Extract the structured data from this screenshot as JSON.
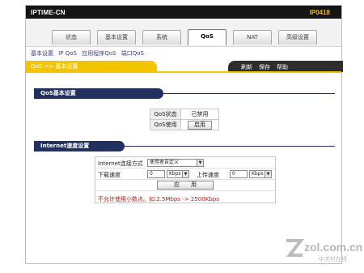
{
  "header": {
    "brand": "IPTIME-CN",
    "model": "IP0418"
  },
  "tabs": [
    "状态",
    "基本设置",
    "系统",
    "QoS",
    "NAT",
    "高级设置"
  ],
  "submenu": [
    "基本设置",
    "IP QoS",
    "应用程序QoS",
    "端口QoS"
  ],
  "page_title": "QoS >> 基本设置",
  "actions": [
    "刷新",
    "保存",
    "帮助"
  ],
  "qos_section": {
    "title": "QoS基本设置",
    "status_label": "QoS状态",
    "status_value": "已禁用",
    "use_label": "QoS使用",
    "enable_button": "启用"
  },
  "speed_section": {
    "title": "Internet速度设置",
    "method_label": "Internet连接方式",
    "method_value": "使用者自定义",
    "download_label": "下载速度",
    "download_value": "0",
    "download_unit": "Kbps",
    "upload_label": "上传速度",
    "upload_value": "0",
    "upload_unit": "Kbps",
    "apply_button": "应　　用",
    "note": "不允许使用小数点。如:2.5Mbps -> 2500Kbps"
  },
  "watermark": {
    "text": "zol.com.cn",
    "sub": "中关村在线"
  }
}
